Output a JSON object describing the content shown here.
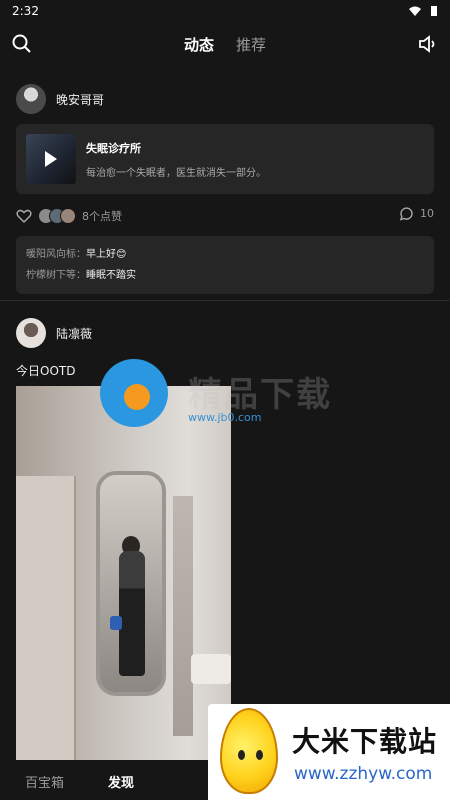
{
  "status_bar": {
    "time": "2:32"
  },
  "header": {
    "tabs": [
      "动态",
      "推荐"
    ]
  },
  "post1": {
    "username": "晚安哥哥",
    "share_card": {
      "title": "失眠诊疗所",
      "description": "每治愈一个失眠者，医生就消失一部分。"
    },
    "likes_text": "8个点赞",
    "comment_count": "10",
    "comments": [
      {
        "author": "暖阳风向标：",
        "text": "早上好😊"
      },
      {
        "author": "柠檬树下等：",
        "text": "睡眠不踏实"
      }
    ]
  },
  "post2": {
    "username": "陆凛薇",
    "caption": "今日OOTD"
  },
  "watermark": {
    "text": "精品下载",
    "url": "www.jb0.com"
  },
  "bottom_nav": {
    "items": [
      "百宝箱",
      "发现"
    ]
  },
  "ad": {
    "title": "大米下载站",
    "url": "www.zzhyw.com"
  },
  "colors": {
    "background": "#161616",
    "card": "#262626",
    "accent_blue": "#2a97e0"
  }
}
